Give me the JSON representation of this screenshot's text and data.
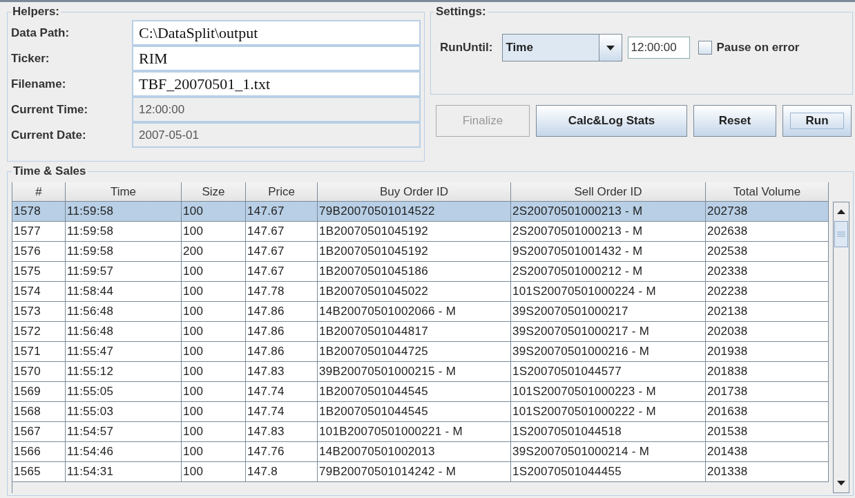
{
  "helpers": {
    "title": "Helpers:",
    "fields": [
      {
        "label": "Data Path:",
        "value": "C:\\DataSplit\\output",
        "disabled": false
      },
      {
        "label": "Ticker:",
        "value": "RIM",
        "disabled": false
      },
      {
        "label": "Filename:",
        "value": "TBF_20070501_1.txt",
        "disabled": false
      },
      {
        "label": "Current Time:",
        "value": "12:00:00",
        "disabled": true
      },
      {
        "label": "Current Date:",
        "value": "2007-05-01",
        "disabled": true
      }
    ]
  },
  "settings": {
    "title": "Settings:",
    "run_until_label": "RunUntil:",
    "run_until_value": "Time",
    "time_value": "12:00:00",
    "pause_on_error": {
      "label": "Pause on error",
      "checked": false
    }
  },
  "buttons": [
    {
      "label": "Finalize",
      "disabled": true,
      "focused": false
    },
    {
      "label": "Calc&Log Stats",
      "disabled": false,
      "focused": false
    },
    {
      "label": "Reset",
      "disabled": false,
      "focused": false
    },
    {
      "label": "Run",
      "disabled": false,
      "focused": true
    }
  ],
  "table": {
    "title": "Time & Sales",
    "columns": [
      "#",
      "Time",
      "Size",
      "Price",
      "Buy Order ID",
      "Sell Order ID",
      "Total Volume"
    ],
    "rows": [
      {
        "cells": [
          "1578",
          "11:59:58",
          "100",
          "147.67",
          "79B20070501014522",
          "2S20070501000213 - M",
          "202738"
        ],
        "selected": true
      },
      {
        "cells": [
          "1577",
          "11:59:58",
          "100",
          "147.67",
          "1B20070501045192",
          "2S20070501000213 - M",
          "202638"
        ],
        "selected": false
      },
      {
        "cells": [
          "1576",
          "11:59:58",
          "200",
          "147.67",
          "1B20070501045192",
          "9S20070501001432 - M",
          "202538"
        ],
        "selected": false
      },
      {
        "cells": [
          "1575",
          "11:59:57",
          "100",
          "147.67",
          "1B20070501045186",
          "2S20070501000212 - M",
          "202338"
        ],
        "selected": false
      },
      {
        "cells": [
          "1574",
          "11:58:44",
          "100",
          "147.78",
          "1B20070501045022",
          "101S20070501000224 - M",
          "202238"
        ],
        "selected": false
      },
      {
        "cells": [
          "1573",
          "11:56:48",
          "100",
          "147.86",
          "14B20070501002066 - M",
          "39S20070501000217",
          "202138"
        ],
        "selected": false
      },
      {
        "cells": [
          "1572",
          "11:56:48",
          "100",
          "147.86",
          "1B20070501044817",
          "39S20070501000217 - M",
          "202038"
        ],
        "selected": false
      },
      {
        "cells": [
          "1571",
          "11:55:47",
          "100",
          "147.86",
          "1B20070501044725",
          "39S20070501000216 - M",
          "201938"
        ],
        "selected": false
      },
      {
        "cells": [
          "1570",
          "11:55:12",
          "100",
          "147.83",
          "39B20070501000215 - M",
          "1S20070501044577",
          "201838"
        ],
        "selected": false
      },
      {
        "cells": [
          "1569",
          "11:55:05",
          "100",
          "147.74",
          "1B20070501044545",
          "101S20070501000223 - M",
          "201738"
        ],
        "selected": false
      },
      {
        "cells": [
          "1568",
          "11:55:03",
          "100",
          "147.74",
          "1B20070501044545",
          "101S20070501000222 - M",
          "201638"
        ],
        "selected": false
      },
      {
        "cells": [
          "1567",
          "11:54:57",
          "100",
          "147.83",
          "101B20070501000221 - M",
          "1S20070501044518",
          "201538"
        ],
        "selected": false
      },
      {
        "cells": [
          "1566",
          "11:54:46",
          "100",
          "147.76",
          "14B20070501002013",
          "39S20070501000214 - M",
          "201438"
        ],
        "selected": false
      },
      {
        "cells": [
          "1565",
          "11:54:31",
          "100",
          "147.8",
          "79B20070501014242 - M",
          "1S20070501044455",
          "201338"
        ],
        "selected": false
      }
    ]
  }
}
